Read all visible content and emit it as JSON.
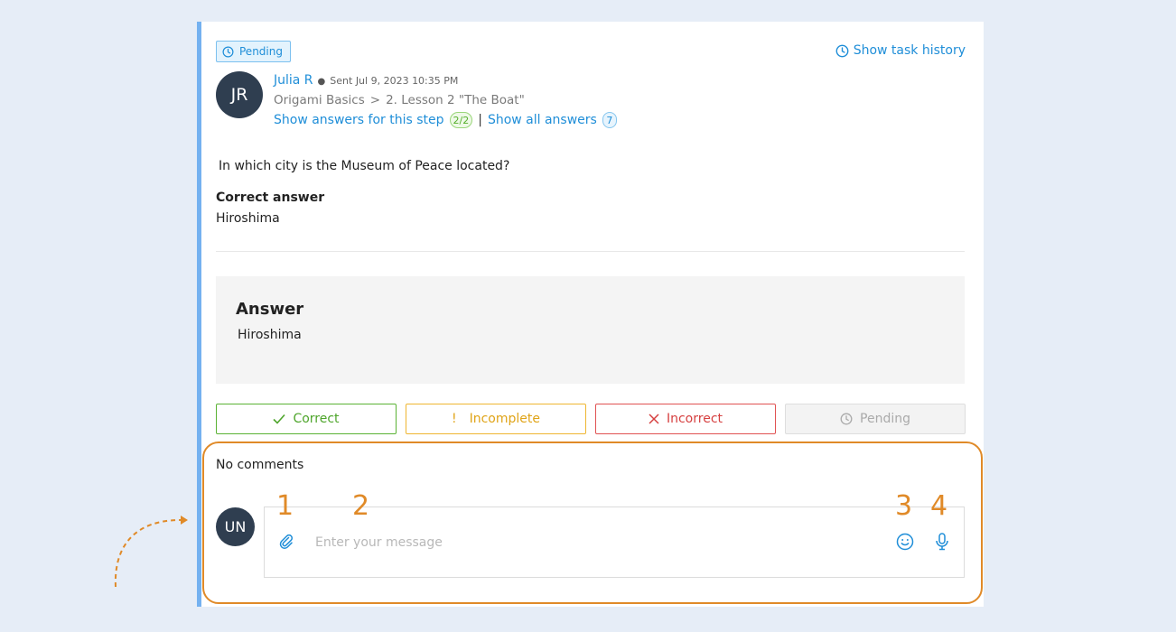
{
  "task": {
    "status_badge": "Pending",
    "history_link": "Show task history",
    "user": {
      "initials": "JR",
      "name": "Julia R",
      "sent": "Sent Jul 9, 2023 10:35 PM"
    },
    "breadcrumb": {
      "course": "Origami Basics",
      "separator": ">",
      "lesson": "2. Lesson 2 \"The Boat\""
    },
    "links": {
      "step_answers": "Show answers for this step",
      "step_answers_count": "2/2",
      "divider": "|",
      "all_answers": "Show all answers",
      "all_answers_count": "7"
    },
    "question": "In which city is the Museum of Peace located?",
    "correct_answer_title": "Correct answer",
    "correct_answer_value": "Hiroshima"
  },
  "answer": {
    "title": "Answer",
    "text": "Hiroshima"
  },
  "grading": {
    "correct": "Correct",
    "incomplete_mark": "!",
    "incomplete": "Incomplete",
    "incorrect": "Incorrect",
    "pending": "Pending"
  },
  "comments": {
    "title": "No comments",
    "avatar_initials": "UN",
    "placeholder": "Enter your message"
  },
  "annotations": {
    "markers": [
      "1",
      "2",
      "3",
      "4"
    ],
    "accent_color": "#e08a28"
  },
  "colors": {
    "link": "#1f8ed8",
    "correct": "#4ea52b",
    "incomplete": "#e0a418",
    "incorrect": "#d64040",
    "card_accent": "#74b1f0"
  }
}
